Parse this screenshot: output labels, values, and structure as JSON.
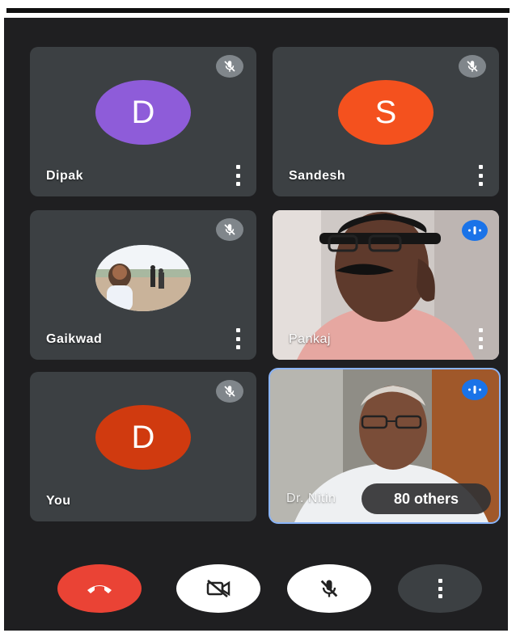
{
  "participants": [
    {
      "name": "Dipak",
      "initial": "D",
      "color": "#8e5cd9",
      "muted": true
    },
    {
      "name": "Sandesh",
      "initial": "S",
      "color": "#f4511e",
      "muted": true
    },
    {
      "name": "Gaikwad",
      "initial": "",
      "muted": true
    },
    {
      "name": "Pankaj",
      "speaking": true
    },
    {
      "name": "You",
      "initial": "D",
      "color": "#d03a0f",
      "muted": true
    },
    {
      "name": "Dr. Nitin",
      "speaking": true
    }
  ],
  "others_label": "80 others",
  "controls": {
    "end_call_color": "#ea4335",
    "camera": "camera-off",
    "mic": "mic-off",
    "more": "more-options"
  },
  "colors": {
    "tile_bg": "#3c4043",
    "screen_bg": "#1f1f21",
    "accent_blue": "#1a73e8"
  }
}
